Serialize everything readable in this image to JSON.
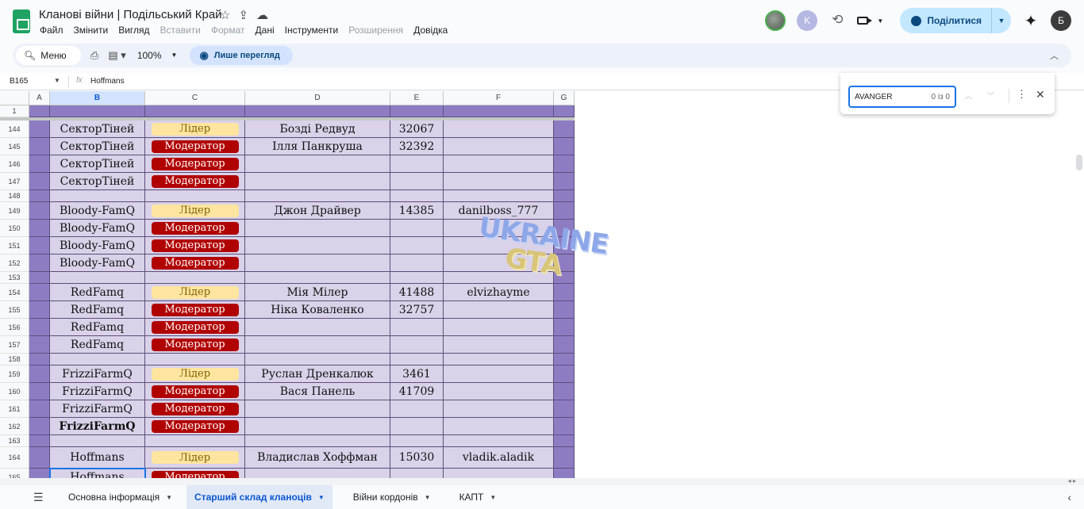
{
  "doc": {
    "title": "Кланові війни | Подільський Край",
    "star_icon": "☆",
    "move_icon": "⇪",
    "cloud_icon": "☁"
  },
  "menu": [
    {
      "label": "Файл",
      "enabled": true
    },
    {
      "label": "Змінити",
      "enabled": true
    },
    {
      "label": "Вигляд",
      "enabled": true
    },
    {
      "label": "Вставити",
      "enabled": false
    },
    {
      "label": "Формат",
      "enabled": false
    },
    {
      "label": "Дані",
      "enabled": true
    },
    {
      "label": "Інструменти",
      "enabled": true
    },
    {
      "label": "Розширення",
      "enabled": false
    },
    {
      "label": "Довідка",
      "enabled": true
    }
  ],
  "header": {
    "avatar_k": "K",
    "share_label": "Поділитися",
    "avatar_b": "Б"
  },
  "toolbar": {
    "search_label": "Меню",
    "zoom": "100%",
    "view_only": "Лише перегляд"
  },
  "formula": {
    "cell_ref": "B165",
    "fx": "fx",
    "value": "Hoffmans"
  },
  "find": {
    "query": "AVANGER",
    "count": "0 із 0"
  },
  "columns": [
    "A",
    "B",
    "C",
    "D",
    "E",
    "F",
    "G"
  ],
  "rows": [
    {
      "num": "1",
      "type": "header"
    },
    {
      "num": "144",
      "clan": "СекторТіней",
      "role": "Лідер",
      "name": "Бозді Редвуд",
      "id": "32067",
      "extra": ""
    },
    {
      "num": "145",
      "clan": "СекторТіней",
      "role": "Модератор",
      "name": "Ілля Панкруша",
      "id": "32392",
      "extra": ""
    },
    {
      "num": "146",
      "clan": "СекторТіней",
      "role": "Модератор",
      "name": "",
      "id": "",
      "extra": ""
    },
    {
      "num": "147",
      "clan": "СекторТіней",
      "role": "Модератор",
      "name": "",
      "id": "",
      "extra": ""
    },
    {
      "num": "148",
      "type": "blank"
    },
    {
      "num": "149",
      "clan": "Bloody-FamQ",
      "role": "Лідер",
      "name": "Джон Драйвер",
      "id": "14385",
      "extra": "danilboss_777"
    },
    {
      "num": "150",
      "clan": "Bloody-FamQ",
      "role": "Модератор",
      "name": "",
      "id": "",
      "extra": ""
    },
    {
      "num": "151",
      "clan": "Bloody-FamQ",
      "role": "Модератор",
      "name": "",
      "id": "",
      "extra": ""
    },
    {
      "num": "152",
      "clan": "Bloody-FamQ",
      "role": "Модератор",
      "name": "",
      "id": "",
      "extra": ""
    },
    {
      "num": "153",
      "type": "blank"
    },
    {
      "num": "154",
      "clan": "RedFamq",
      "role": "Лідер",
      "name": "Мія Мілер",
      "id": "41488",
      "extra": "elvizhayme"
    },
    {
      "num": "155",
      "clan": "RedFamq",
      "role": "Модератор",
      "name": "Ніка Коваленко",
      "id": "32757",
      "extra": ""
    },
    {
      "num": "156",
      "clan": "RedFamq",
      "role": "Модератор",
      "name": "",
      "id": "",
      "extra": ""
    },
    {
      "num": "157",
      "clan": "RedFamq",
      "role": "Модератор",
      "name": "",
      "id": "",
      "extra": ""
    },
    {
      "num": "158",
      "type": "blank"
    },
    {
      "num": "159",
      "clan": "FrizziFarmQ",
      "role": "Лідер",
      "name": "Руслан Дренкалюк",
      "id": "3461",
      "extra": ""
    },
    {
      "num": "160",
      "clan": "FrizziFarmQ",
      "role": "Модератор",
      "name": "Вася Панель",
      "id": "41709",
      "extra": ""
    },
    {
      "num": "161",
      "clan": "FrizziFarmQ",
      "role": "Модератор",
      "name": "",
      "id": "",
      "extra": ""
    },
    {
      "num": "162",
      "clan": "FrizziFarmQ",
      "role": "Модератор",
      "name": "",
      "id": "",
      "extra": "",
      "bold": true
    },
    {
      "num": "163",
      "type": "blank"
    },
    {
      "num": "164",
      "clan": "Hoffmans",
      "role": "Лідер",
      "name": "Владислав Хоффман",
      "id": "15030",
      "extra": "vladik.aladik"
    },
    {
      "num": "165",
      "clan": "Hoffmans",
      "role": "Модератор",
      "name": "",
      "id": "",
      "extra": ""
    }
  ],
  "sheet_tabs": [
    {
      "label": "Основна інформація",
      "active": false
    },
    {
      "label": "Старший склад кланоців",
      "active": true
    },
    {
      "label": "Війни кордонів",
      "active": false
    },
    {
      "label": "КАПТ",
      "active": false
    }
  ]
}
